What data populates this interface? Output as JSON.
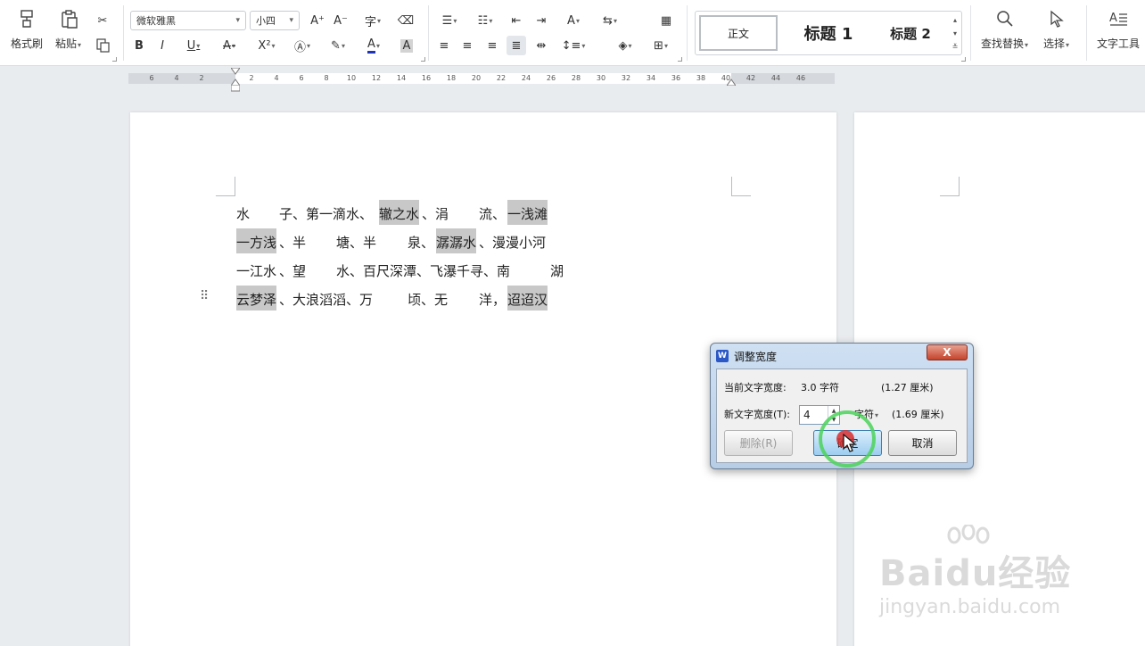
{
  "ribbon": {
    "format_painter_label": "格式刷",
    "paste_label": "粘贴",
    "font_name": "微软雅黑",
    "font_size": "小四",
    "styles": {
      "normal": "正文",
      "heading1": "标题 1",
      "heading2": "标题 2"
    },
    "find_replace_label": "查找替换",
    "select_label": "选择",
    "text_tools_label": "文字工具"
  },
  "ruler": {
    "ticks": [
      "6",
      "4",
      "2",
      "2",
      "4",
      "6",
      "8",
      "10",
      "12",
      "14",
      "16",
      "18",
      "20",
      "22",
      "24",
      "26",
      "28",
      "30",
      "32",
      "34",
      "36",
      "38",
      "40",
      "42",
      "44",
      "46"
    ]
  },
  "document": {
    "lines": [
      [
        {
          "t": "水",
          "hl": false
        },
        {
          "t": "子、第一滴水、",
          "hl": false
        },
        {
          "t": "辙之水",
          "hl": true
        },
        {
          "t": "、涓",
          "hl": false
        },
        {
          "t": "流、",
          "hl": false
        },
        {
          "t": "一浅滩",
          "hl": true
        }
      ],
      [
        {
          "t": "一方浅",
          "hl": true
        },
        {
          "t": "、半",
          "hl": false
        },
        {
          "t": "塘、半",
          "hl": false
        },
        {
          "t": "泉、",
          "hl": false
        },
        {
          "t": "潺潺水",
          "hl": true
        },
        {
          "t": "、漫漫小河",
          "hl": false
        }
      ],
      [
        {
          "t": "一江水",
          "hl": false
        },
        {
          "t": "、望",
          "hl": false
        },
        {
          "t": "水、百尺深潭、飞瀑千寻、南",
          "hl": false
        },
        {
          "t": "湖",
          "hl": false
        }
      ],
      [
        {
          "t": "云梦泽",
          "hl": true
        },
        {
          "t": "、大浪滔滔、万",
          "hl": false
        },
        {
          "t": "顷、无",
          "hl": false
        },
        {
          "t": "洋，",
          "hl": false
        },
        {
          "t": "迢迢汉",
          "hl": true
        }
      ]
    ]
  },
  "dialog": {
    "title": "调整宽度",
    "close_label": "X",
    "current_width_label": "当前文字宽度:",
    "current_width_value": "3.0 字符",
    "current_width_cm": "(1.27 厘米)",
    "new_width_label": "新文字宽度(T):",
    "new_width_value": "4",
    "unit_label": "字符",
    "new_width_cm": "(1.69 厘米)",
    "delete_label": "删除(R)",
    "ok_label": "确定",
    "cancel_label": "取消"
  },
  "watermark": {
    "brand": "Baidu经验",
    "url": "jingyan.baidu.com"
  }
}
